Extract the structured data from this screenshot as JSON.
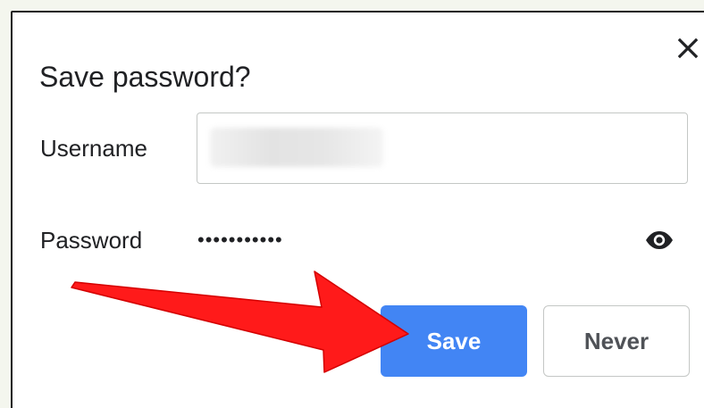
{
  "dialog": {
    "title": "Save password?",
    "close_icon": "close-icon",
    "fields": {
      "username_label": "Username",
      "username_value": "",
      "password_label": "Password",
      "password_value": "•••••••••••",
      "reveal_icon": "eye-icon"
    },
    "buttons": {
      "save_label": "Save",
      "never_label": "Never"
    }
  },
  "annotation": {
    "arrow_icon": "red-arrow-icon",
    "arrow_color": "#ff1a1a"
  },
  "colors": {
    "accent": "#4285f4",
    "frame": "#1c1c1c",
    "backdrop": "#f4f6ee"
  }
}
